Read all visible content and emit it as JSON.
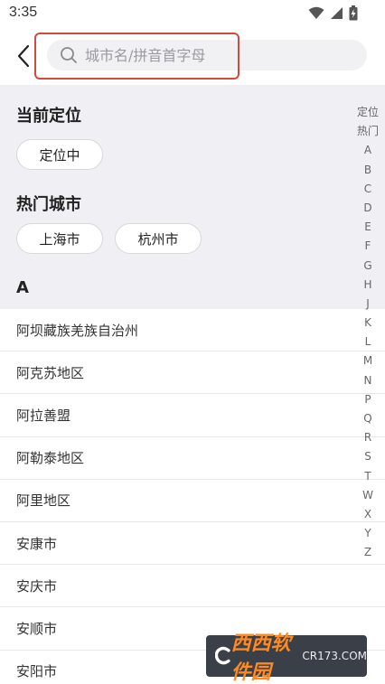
{
  "status_bar": {
    "time": "3:35"
  },
  "search": {
    "placeholder": "城市名/拼音首字母"
  },
  "current_location": {
    "title": "当前定位",
    "chip": "定位中"
  },
  "hot_cities": {
    "title": "热门城市",
    "items": [
      "上海市",
      "杭州市"
    ]
  },
  "section_letter": "A",
  "cities": [
    "阿坝藏族羌族自治州",
    "阿克苏地区",
    "阿拉善盟",
    "阿勒泰地区",
    "阿里地区",
    "安康市",
    "安庆市",
    "安顺市",
    "安阳市"
  ],
  "index_bar": [
    "定位",
    "热门",
    "A",
    "B",
    "C",
    "D",
    "E",
    "F",
    "G",
    "H",
    "J",
    "K",
    "L",
    "M",
    "N",
    "P",
    "Q",
    "R",
    "S",
    "T",
    "W",
    "X",
    "Y",
    "Z"
  ],
  "watermark": {
    "brand": "西西软件园",
    "site": "CR173.COM"
  },
  "colors": {
    "highlight": "#d6493a",
    "background_gray": "#efeff4"
  }
}
